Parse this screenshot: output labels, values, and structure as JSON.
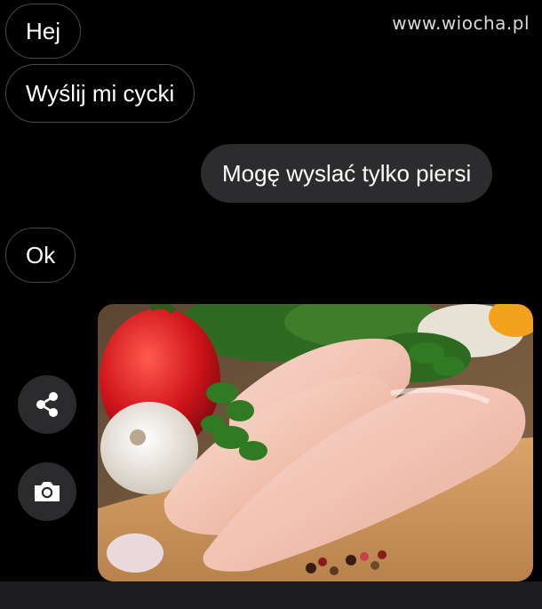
{
  "watermark": "www.wiocha.pl",
  "messages": [
    {
      "direction": "incoming",
      "text": "Hej"
    },
    {
      "direction": "incoming",
      "text": "Wyślij mi cycki"
    },
    {
      "direction": "outgoing",
      "text": "Mogę wyslać tylko piersi"
    },
    {
      "direction": "incoming",
      "text": "Ok"
    }
  ],
  "attachment": {
    "type": "photo",
    "subject": "raw chicken breasts on cutting board with pepper, garlic and parsley"
  },
  "actions": [
    {
      "name": "share",
      "icon": "share-icon"
    },
    {
      "name": "camera",
      "icon": "camera-icon"
    }
  ],
  "colors": {
    "background": "#000000",
    "outgoing_bubble": "#2c2c2e",
    "incoming_border": "#4a4a4a",
    "text": "#ffffff"
  }
}
